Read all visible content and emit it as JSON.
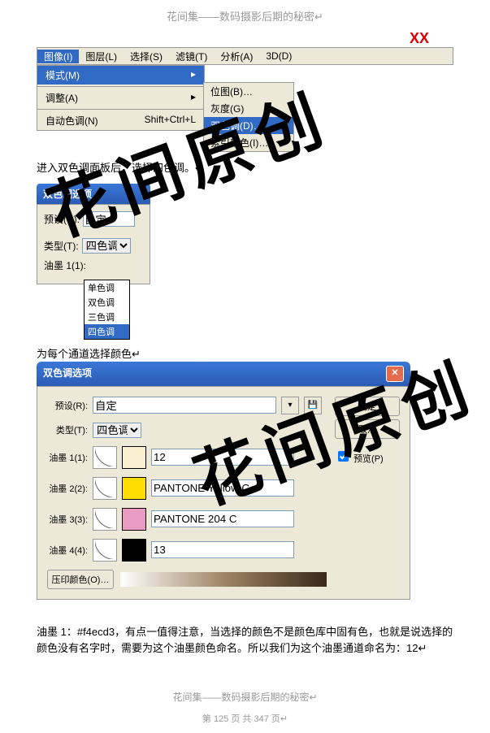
{
  "header_title": "花间集——数码摄影后期的秘密↵",
  "xx": "XX",
  "menubar": {
    "image": "图像(I)",
    "layer": "图层(L)",
    "select": "选择(S)",
    "filter": "滤镜(T)",
    "analyze": "分析(A)",
    "threeD": "3D(D)"
  },
  "submenu1": {
    "mode": "模式(M)",
    "adjust": "调整(A)",
    "auto": "自动色调(N)",
    "shortcut": "Shift+Ctrl+L"
  },
  "submenu2": {
    "bitmap": "位图(B)…",
    "gray": "灰度(G)",
    "duotone": "双色调(D)…",
    "indexed": "索引颜色(I)…"
  },
  "text1": "进入双色调面板后，选择四色调。↵",
  "dlg1": {
    "title": "双色调选项",
    "preset_lbl": "预设(R):",
    "preset_val": "自定",
    "type_lbl": "类型(T):",
    "type_val": "四色调",
    "ink1_lbl": "油墨 1(1):",
    "dd": {
      "o1": "单色调",
      "o2": "双色调",
      "o3": "三色调",
      "o4": "四色调"
    }
  },
  "text2": "为每个通道选择颜色↵",
  "dlg2": {
    "title": "双色调选项",
    "preset_lbl": "预设(R):",
    "preset_val": "自定",
    "type_lbl": "类型(T):",
    "type_val": "四色调",
    "ink1_lbl": "油墨 1(1):",
    "ink1_name": "12",
    "ink1_color": "#f9f0d2",
    "ink2_lbl": "油墨 2(2):",
    "ink2_name": "PANTONE Yellow C",
    "ink2_color": "#ffdd00",
    "ink3_lbl": "油墨 3(3):",
    "ink3_name": "PANTONE 204 C",
    "ink3_color": "#e99bc1",
    "ink4_lbl": "油墨 4(4):",
    "ink4_name": "13",
    "ink4_color": "#000000",
    "overprint_lbl": "压印颜色(O)…",
    "ok": "确定",
    "cancel": "取消",
    "preview": "预览(P)"
  },
  "text3": "油墨 1：#f4ecd3，有点一值得注意，当选择的颜色不是颜色库中固有色，也就是说选择的颜色没有名字时，需要为这个油墨颜色命名。所以我们为这个油墨通道命名为：12↵",
  "watermark": "花间原创",
  "footer1": "花间集——数码摄影后期的秘密↵",
  "footer2": "第 125 页 共 347 页↵"
}
